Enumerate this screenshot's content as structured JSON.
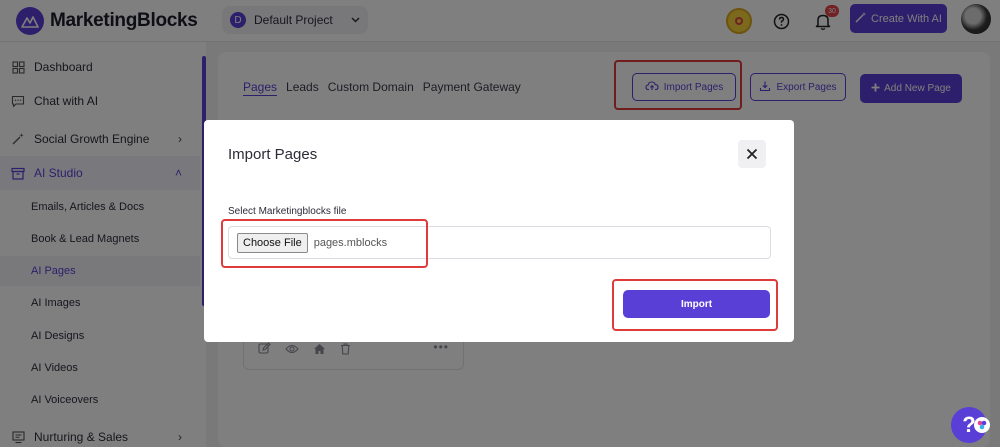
{
  "app": {
    "brand": "MarketingBlocks"
  },
  "header": {
    "project": {
      "badge": "D",
      "name": "Default Project"
    },
    "notification_count": "30",
    "create_label": "Create With AI"
  },
  "sidebar": {
    "items": [
      {
        "label": "Dashboard",
        "icon": "dashboard-icon"
      },
      {
        "label": "Chat with AI",
        "icon": "chat-icon"
      },
      {
        "label": "Social Growth Engine",
        "icon": "magic-wand-icon",
        "arrow": "›"
      },
      {
        "label": "AI Studio",
        "icon": "ai-studio-icon",
        "arrow": "˄"
      }
    ],
    "sub_items": [
      "Emails, Articles & Docs",
      "Book & Lead Magnets",
      "AI Pages",
      "AI Images",
      "AI Designs",
      "AI Videos",
      "AI Voiceovers"
    ],
    "bottom_item": {
      "label": "Nurturing & Sales",
      "icon": "nurturing-icon",
      "arrow": "›"
    }
  },
  "main": {
    "tabs": [
      "Pages",
      "Leads",
      "Custom Domain",
      "Payment Gateway"
    ],
    "active_tab": "Pages",
    "import_label": "Import Pages",
    "export_label": "Export Pages",
    "add_label": "Add New Page"
  },
  "modal": {
    "title": "Import Pages",
    "field_label": "Select Marketingblocks file",
    "choose_label": "Choose File",
    "file_name": "pages.mblocks",
    "import_label": "Import"
  },
  "help_glyph": "?",
  "colors": {
    "accent": "#5a3fd6",
    "highlight": "#e03b3b"
  }
}
